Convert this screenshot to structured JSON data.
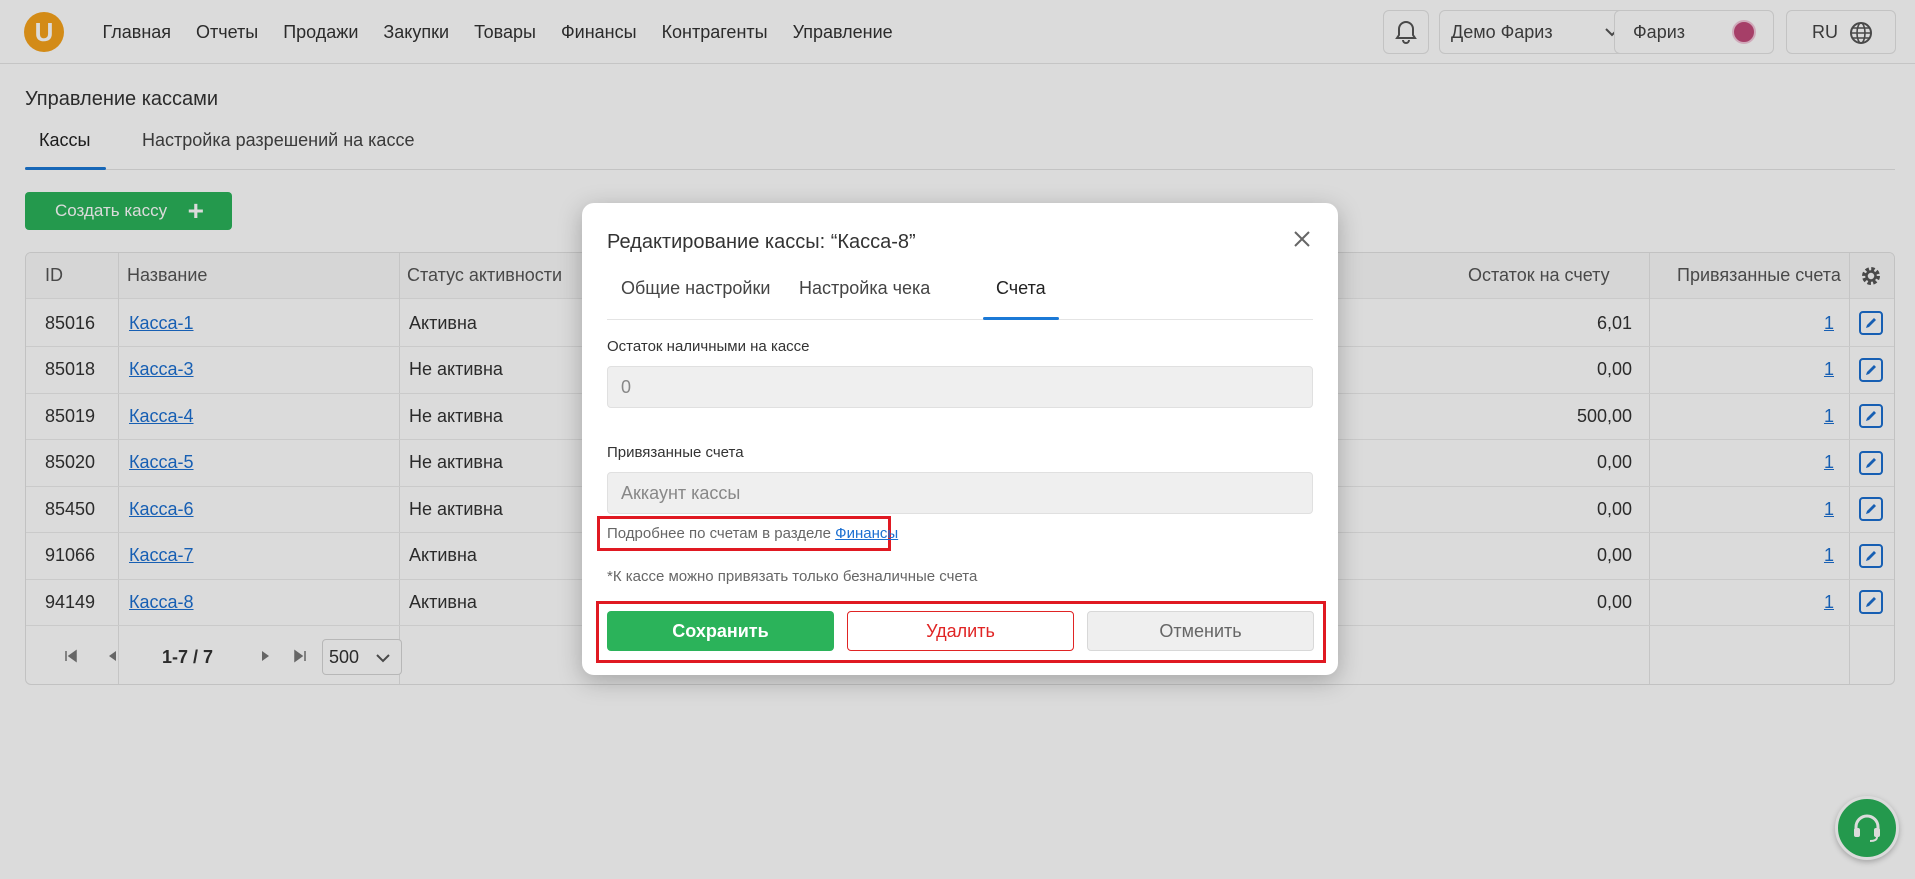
{
  "header": {
    "logo_letter": "U",
    "nav": [
      "Главная",
      "Отчеты",
      "Продажи",
      "Закупки",
      "Товары",
      "Финансы",
      "Контрагенты",
      "Управление"
    ],
    "company": "Демо Фариз",
    "user": "Фариз",
    "language": "RU"
  },
  "page": {
    "title": "Управление кассами",
    "tabs": [
      "Кассы",
      "Настройка разрешений на кассе"
    ],
    "create_button": "Создать кассу"
  },
  "table": {
    "columns": [
      "ID",
      "Название",
      "Статус активности",
      "Остаток на счету",
      "Привязанные счета"
    ],
    "rows": [
      {
        "id": "85016",
        "name": "Касса-1",
        "status": "Активна",
        "balance": "6,01",
        "accounts": "1"
      },
      {
        "id": "85018",
        "name": "Касса-3",
        "status": "Не активна",
        "balance": "0,00",
        "accounts": "1"
      },
      {
        "id": "85019",
        "name": "Касса-4",
        "status": "Не активна",
        "balance": "500,00",
        "accounts": "1"
      },
      {
        "id": "85020",
        "name": "Касса-5",
        "status": "Не активна",
        "balance": "0,00",
        "accounts": "1"
      },
      {
        "id": "85450",
        "name": "Касса-6",
        "status": "Не активна",
        "balance": "0,00",
        "accounts": "1"
      },
      {
        "id": "91066",
        "name": "Касса-7",
        "status": "Активна",
        "balance": "0,00",
        "accounts": "1"
      },
      {
        "id": "94149",
        "name": "Касса-8",
        "status": "Активна",
        "balance": "0,00",
        "accounts": "1"
      }
    ],
    "pager": {
      "range": "1-7 / 7",
      "page_size": "500"
    }
  },
  "modal": {
    "title": "Редактирование кассы: “Касса-8”",
    "tabs": [
      "Общие настройки",
      "Настройка чека",
      "Счета"
    ],
    "cash_label": "Остаток наличными на кассе",
    "cash_value": "0",
    "accounts_label": "Привязанные счета",
    "accounts_placeholder": "Аккаунт кассы",
    "hint_text": "Подробнее по счетам в разделе ",
    "hint_link": "Финансы",
    "note": "*К кассе можно привязать только безналичные счета",
    "save": "Сохранить",
    "delete": "Удалить",
    "cancel": "Отменить"
  },
  "colors": {
    "accent": "#1b79d6",
    "primary_green": "#2bb35a",
    "danger": "#e02424",
    "highlight": "#e01922"
  }
}
